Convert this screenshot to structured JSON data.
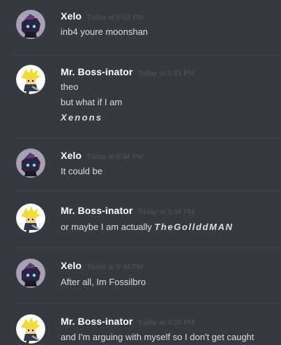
{
  "messages": [
    {
      "username": "Xelo",
      "timestamp": "Today at 9:33 PM",
      "avatar_icon": "xelo-avatar-icon",
      "lines": [
        {
          "text": "inb4 youre moonshan"
        }
      ]
    },
    {
      "username": "Mr. Boss-inator",
      "timestamp": "Today at 9:33 PM",
      "avatar_icon": "boss-avatar-icon",
      "lines": [
        {
          "text": "theo"
        },
        {
          "text": "but what if I am"
        },
        {
          "styled": "Xenons"
        }
      ]
    },
    {
      "username": "Xelo",
      "timestamp": "Today at 9:34 PM",
      "avatar_icon": "xelo-avatar-icon",
      "lines": [
        {
          "text": "It could be"
        }
      ]
    },
    {
      "username": "Mr. Boss-inator",
      "timestamp": "Today at 9:34 PM",
      "avatar_icon": "boss-avatar-icon",
      "lines": [
        {
          "text": "or maybe I am actually ",
          "styled": "TheGollddMAN"
        }
      ]
    },
    {
      "username": "Xelo",
      "timestamp": "Today at 9:34 PM",
      "avatar_icon": "xelo-avatar-icon",
      "lines": [
        {
          "text": "After all, Im Fossilbro"
        }
      ]
    },
    {
      "username": "Mr. Boss-inator",
      "timestamp": "Today at 9:34 PM",
      "avatar_icon": "boss-avatar-icon",
      "lines": [
        {
          "text": "and I'm arguing with myself so I don't get caught"
        }
      ]
    }
  ],
  "colors": {
    "background": "#36393f",
    "username": "#ffffff",
    "timestamp": "#4f545c",
    "message_text": "#dcddde",
    "divider": "#3f4248"
  }
}
